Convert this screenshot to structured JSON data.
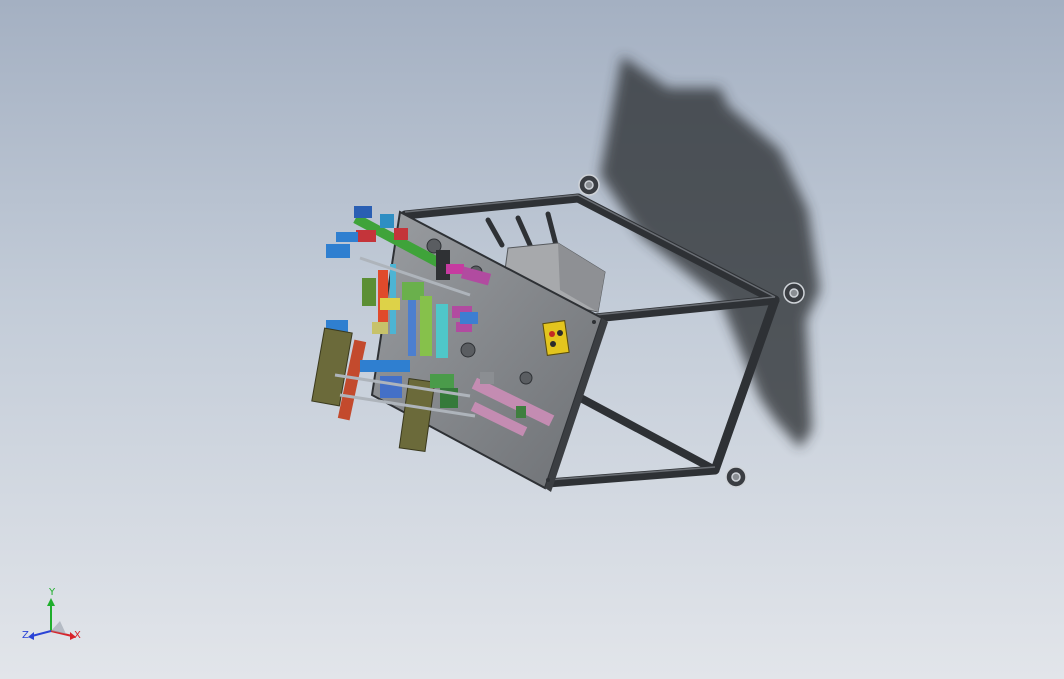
{
  "triad": {
    "x_label": "X",
    "y_label": "Y",
    "z_label": "Z",
    "x_color": "#d8232a",
    "y_color": "#1fae2c",
    "z_color": "#2a44d6"
  },
  "colors": {
    "background_top": "#a4b0c2",
    "background_bottom": "#e2e5ea",
    "shadow": "#2f3135",
    "frame": "#3c3f44",
    "plate": "#86898d"
  }
}
